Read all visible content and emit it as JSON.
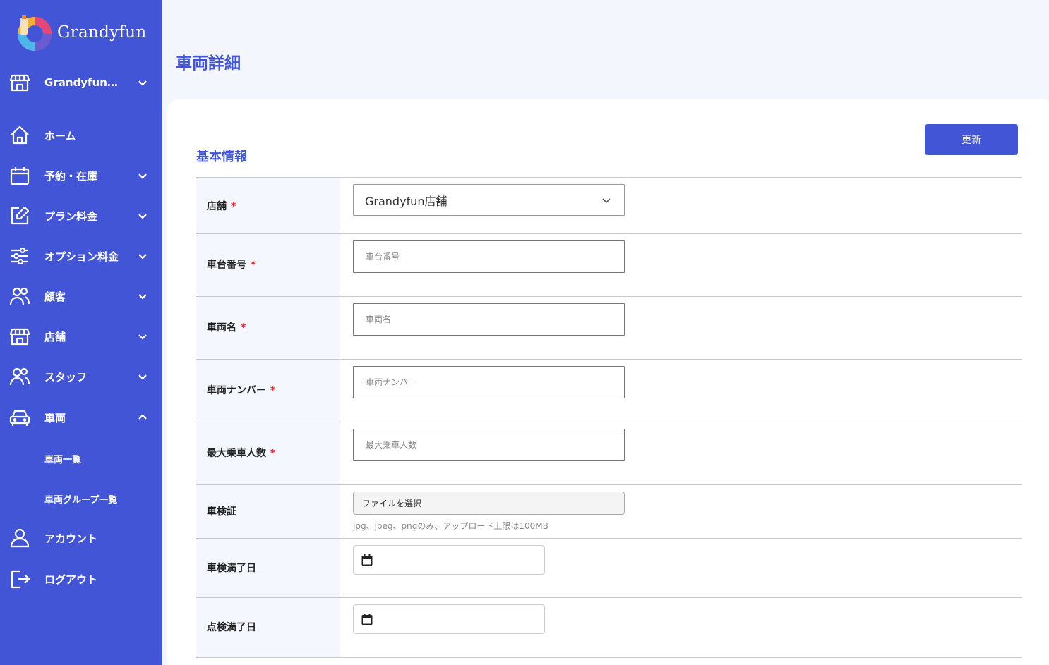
{
  "brand": {
    "name": "Grandyfun",
    "accent": "#4255d6"
  },
  "sidebar": {
    "store_selector": "Grandyfun…",
    "items": [
      {
        "label": "ホーム",
        "icon": "home-icon"
      },
      {
        "label": "予約・在庫",
        "icon": "calendar-icon"
      },
      {
        "label": "プラン料金",
        "icon": "edit-icon"
      },
      {
        "label": "オプション料金",
        "icon": "sliders-icon"
      },
      {
        "label": "顧客",
        "icon": "users-icon"
      },
      {
        "label": "店舗",
        "icon": "store-icon"
      },
      {
        "label": "スタッフ",
        "icon": "users-icon"
      },
      {
        "label": "車両",
        "icon": "car-icon"
      },
      {
        "label": "アカウント",
        "icon": "user-icon"
      },
      {
        "label": "ログアウト",
        "icon": "logout-icon"
      }
    ],
    "vehicle_sub": [
      "車両一覧",
      "車両グループ一覧"
    ]
  },
  "page": {
    "title": "車両詳細"
  },
  "section": {
    "title": "基本情報",
    "update_label": "更新"
  },
  "form": {
    "store": {
      "label": "店舗",
      "required_mark": "*",
      "value": "Grandyfun店舗"
    },
    "car_number": {
      "label": "車台番号",
      "required_mark": "*",
      "placeholder": "車台番号"
    },
    "car_name": {
      "label": "車両名",
      "required_mark": "*",
      "placeholder": "車両名"
    },
    "plate": {
      "label": "車両ナンバー",
      "required_mark": "*",
      "placeholder": "車両ナンバー"
    },
    "capacity": {
      "label": "最大乗車人数",
      "required_mark": "*",
      "placeholder": "最大乗車人数"
    },
    "inspection_cert": {
      "label": "車検証",
      "button": "ファイルを選択",
      "hint": "jpg、jpeg、pngのみ、アップロード上限は100MB"
    },
    "inspection_expiry": {
      "label": "車検満了日"
    },
    "check_expiry": {
      "label": "点検満了日"
    }
  }
}
